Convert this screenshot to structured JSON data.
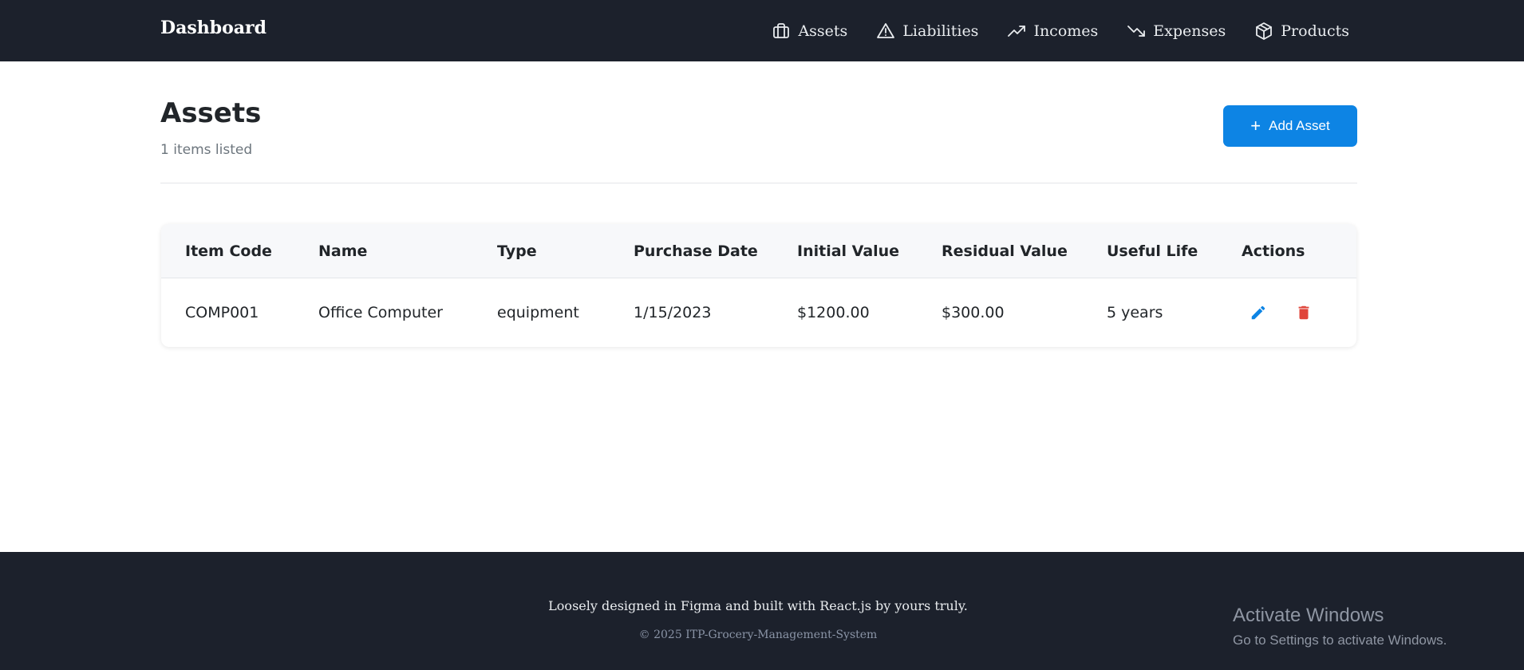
{
  "navbar": {
    "brand": "Dashboard",
    "links": [
      {
        "label": "Assets",
        "icon": "briefcase-icon"
      },
      {
        "label": "Liabilities",
        "icon": "warning-triangle-icon"
      },
      {
        "label": "Incomes",
        "icon": "trending-up-icon"
      },
      {
        "label": "Expenses",
        "icon": "trending-down-icon"
      },
      {
        "label": "Products",
        "icon": "box-icon"
      }
    ]
  },
  "header": {
    "title": "Assets",
    "subtitle": "1 items listed",
    "add_button": {
      "icon": "+",
      "label": "Add Asset"
    }
  },
  "table": {
    "columns": [
      "Item Code",
      "Name",
      "Type",
      "Purchase Date",
      "Initial Value",
      "Residual Value",
      "Useful Life",
      "Actions"
    ],
    "rows": [
      {
        "item_code": "COMP001",
        "name": "Office Computer",
        "type": "equipment",
        "purchase_date": "1/15/2023",
        "initial_value": "$1200.00",
        "residual_value": "$300.00",
        "useful_life": "5 years"
      }
    ]
  },
  "footer": {
    "text": "Loosely designed in Figma and built with React.js by yours truly.",
    "copyright": "© 2025 ITP-Grocery-Management-System"
  },
  "windows_watermark": {
    "title": "Activate Windows",
    "subtitle": "Go to Settings to activate Windows."
  },
  "colors": {
    "navbar_bg": "#1c212c",
    "primary": "#0d84e4",
    "danger": "#e0453a"
  }
}
